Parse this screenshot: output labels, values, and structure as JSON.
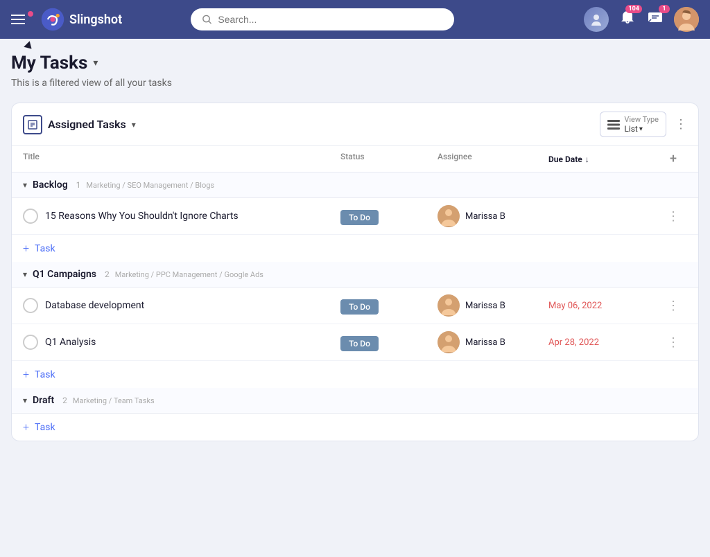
{
  "app": {
    "name": "Slingshot"
  },
  "header": {
    "search_placeholder": "Search...",
    "notifications_count": "104",
    "messages_count": "1"
  },
  "page": {
    "title": "My Tasks",
    "subtitle": "This is a filtered view of all your tasks"
  },
  "panel": {
    "title": "Assigned Tasks",
    "view_type_label": "View Type",
    "view_type_value": "List",
    "add_task_label": "Task"
  },
  "table": {
    "columns": {
      "title": "Title",
      "status": "Status",
      "assignee": "Assignee",
      "due_date": "Due Date"
    }
  },
  "groups": [
    {
      "id": "backlog",
      "name": "Backlog",
      "count": "1",
      "path": "Marketing / SEO Management / Blogs",
      "tasks": [
        {
          "id": "task1",
          "name": "15 Reasons Why You Shouldn't Ignore Charts",
          "status": "To Do",
          "assignee": "Marissa B",
          "due_date": null
        }
      ]
    },
    {
      "id": "q1campaigns",
      "name": "Q1 Campaigns",
      "count": "2",
      "path": "Marketing / PPC Management / Google Ads",
      "tasks": [
        {
          "id": "task2",
          "name": "Database development",
          "status": "To Do",
          "assignee": "Marissa B",
          "due_date": "May 06, 2022",
          "overdue": true
        },
        {
          "id": "task3",
          "name": "Q1 Analysis",
          "status": "To Do",
          "assignee": "Marissa B",
          "due_date": "Apr 28, 2022",
          "overdue": true
        }
      ]
    },
    {
      "id": "draft",
      "name": "Draft",
      "count": "2",
      "path": "Marketing / Team Tasks",
      "tasks": []
    }
  ]
}
